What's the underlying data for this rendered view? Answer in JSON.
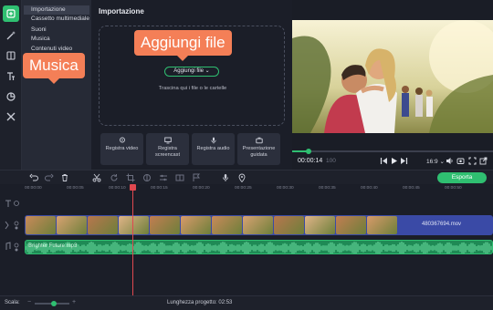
{
  "sidebar": {
    "tools": [
      {
        "name": "import-icon",
        "active": true
      },
      {
        "name": "magic-wand-icon",
        "active": false
      },
      {
        "name": "transitions-icon",
        "active": false
      },
      {
        "name": "text-icon",
        "active": false
      },
      {
        "name": "stickers-icon",
        "active": false
      },
      {
        "name": "tools-icon",
        "active": false
      }
    ],
    "categories": [
      "Importazione",
      "Cassetto multimediale",
      "Suoni",
      "Musica",
      "Contenuti video"
    ]
  },
  "import": {
    "title": "Importazione",
    "add_file_label": "Aggiungi file",
    "drop_hint": "Trascina qui i file o le cartelle",
    "record_buttons": [
      {
        "label": "Registra video",
        "icon": "webcam-icon"
      },
      {
        "label": "Registra screencast",
        "icon": "monitor-icon"
      },
      {
        "label": "Registra audio",
        "icon": "microphone-icon"
      },
      {
        "label": "Presentazione guidata",
        "icon": "briefcase-icon"
      }
    ]
  },
  "callouts": {
    "add_file": "Aggiungi file",
    "music": "Musica"
  },
  "player": {
    "time_current": "00:00:14",
    "time_ms": "100",
    "aspect_ratio": "16:9",
    "progress": 0.08
  },
  "timeline": {
    "export_label": "Esporta",
    "ruler_ticks": [
      "00:00:00",
      "00:00:05",
      "00:00:10",
      "00:00:15",
      "00:00:20",
      "00:00:25",
      "00:00:30",
      "00:00:35",
      "00:00:40",
      "00:00:45",
      "00:00:50"
    ],
    "video_clip_name": "480367694.mov",
    "audio_clip_name": "Brighter Future.mp3"
  },
  "bottombar": {
    "scale_label": "Scala:",
    "scale_level": 0.55,
    "project_length_label": "Lunghezza progetto: 02:53"
  },
  "colors": {
    "accent": "#2fbf71",
    "callout": "#f47f57",
    "playhead": "#e0484f",
    "video_track": "#3a4aa6"
  }
}
